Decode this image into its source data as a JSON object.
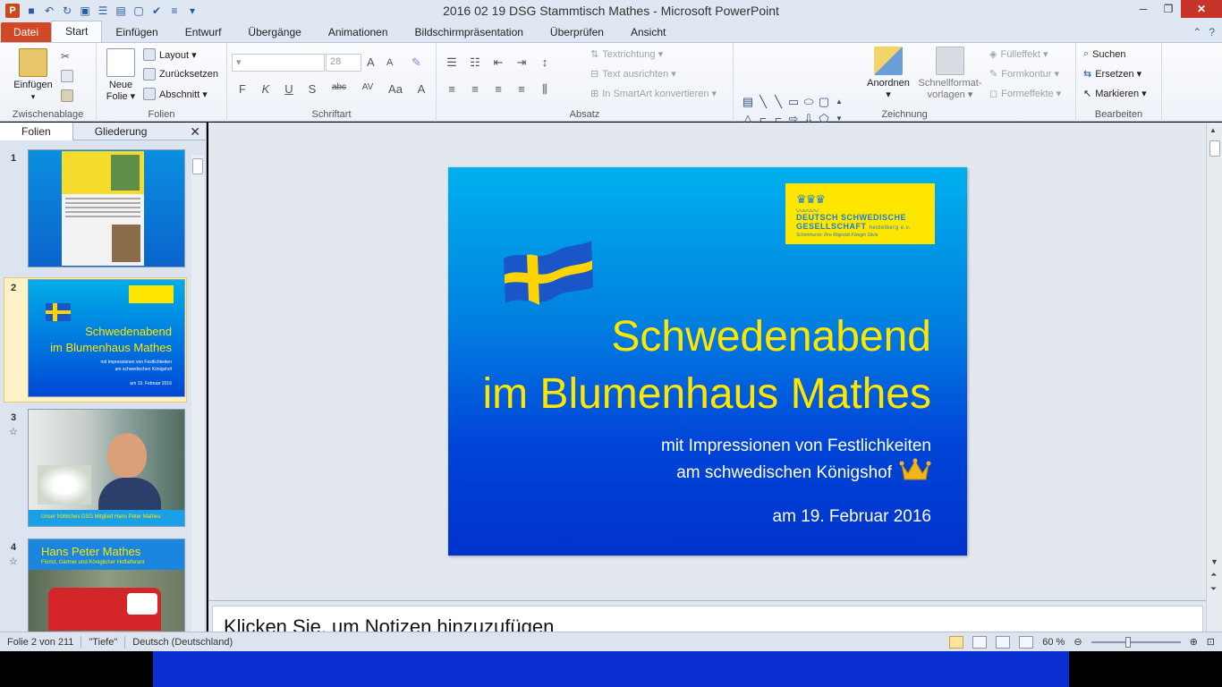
{
  "window": {
    "title": "2016 02 19 DSG Stammtisch Mathes  -  Microsoft PowerPoint",
    "app_icon": "P",
    "qat_icons": [
      "save-icon",
      "undo-icon",
      "redo-icon",
      "slideshow-icon",
      "bullets-icon",
      "layout-icon",
      "new-icon",
      "spelling-icon",
      "align-icon",
      "customize-icon"
    ]
  },
  "tabs": [
    "Datei",
    "Start",
    "Einfügen",
    "Entwurf",
    "Übergänge",
    "Animationen",
    "Bildschirmpräsentation",
    "Überprüfen",
    "Ansicht"
  ],
  "ribbon": {
    "clipboard": {
      "label": "Zwischenablage",
      "paste": "Einfügen"
    },
    "slides": {
      "label": "Folien",
      "new_slide": "Neue",
      "new_slide2": "Folie ▾",
      "layout": "Layout ▾",
      "reset": "Zurücksetzen",
      "section": "Abschnitt ▾"
    },
    "font": {
      "label": "Schriftart",
      "size": "28",
      "format_buttons": [
        "F",
        "K",
        "U",
        "S",
        "abc",
        "AV",
        "Aa",
        "A"
      ]
    },
    "paragraph": {
      "label": "Absatz",
      "text_direction": "Textrichtung ▾",
      "align_text": "Text ausrichten ▾",
      "smartart": "In SmartArt konvertieren ▾"
    },
    "drawing": {
      "label": "Zeichnung",
      "arrange": "Anordnen",
      "arrange2": "▾",
      "quick_styles": "Schnellformat-",
      "quick_styles2": "vorlagen ▾",
      "fill": "Fülleffekt ▾",
      "outline": "Formkontur ▾",
      "effects": "Formeffekte ▾"
    },
    "editing": {
      "label": "Bearbeiten",
      "find": "Suchen",
      "replace": "Ersetzen ▾",
      "select": "Markieren ▾"
    }
  },
  "panel": {
    "tab_slides": "Folien",
    "tab_outline": "Gliederung",
    "close": "✕",
    "thumbnails": [
      {
        "num": "1"
      },
      {
        "num": "2",
        "title1": "Schwedenabend",
        "title2": "im Blumenhaus Mathes",
        "sub1": "mit Impressionen von Festlichkeiten",
        "sub2": "am schwedischen Königshof",
        "date": "am 19. Februar 2016"
      },
      {
        "num": "3",
        "star": "☆",
        "caption": "Unser fröhliches DSG Mitglied Hans Peter Mathes"
      },
      {
        "num": "4",
        "star": "☆",
        "title": "Hans Peter Mathes",
        "sub": "Florist, Gärtner und Königlicher Hoflieferant"
      }
    ]
  },
  "slide": {
    "logo": {
      "line1": "DEUTSCH SCHWEDISCHE",
      "line2": "GESELLSCHAFT",
      "line2b": "heidelberg e.v.",
      "line3": "Schirmherrin: Ihre Majestät Königin Silvia"
    },
    "title_line1": "Schwedenabend",
    "title_line2": "im Blumenhaus Mathes",
    "subtitle_line1": "mit Impressionen von Festlichkeiten",
    "subtitle_line2": "am schwedischen Königshof",
    "date": "am 19. Februar 2016",
    "colors": {
      "title": "#ffe600",
      "flag_blue": "#1a56c8",
      "flag_yellow": "#ffd400"
    }
  },
  "notes": {
    "placeholder": "Klicken Sie, um Notizen hinzuzufügen"
  },
  "status": {
    "slide_info": "Folie 2 von 211",
    "theme": "\"Tiefe\"",
    "language": "Deutsch (Deutschland)",
    "zoom": "60 %"
  }
}
